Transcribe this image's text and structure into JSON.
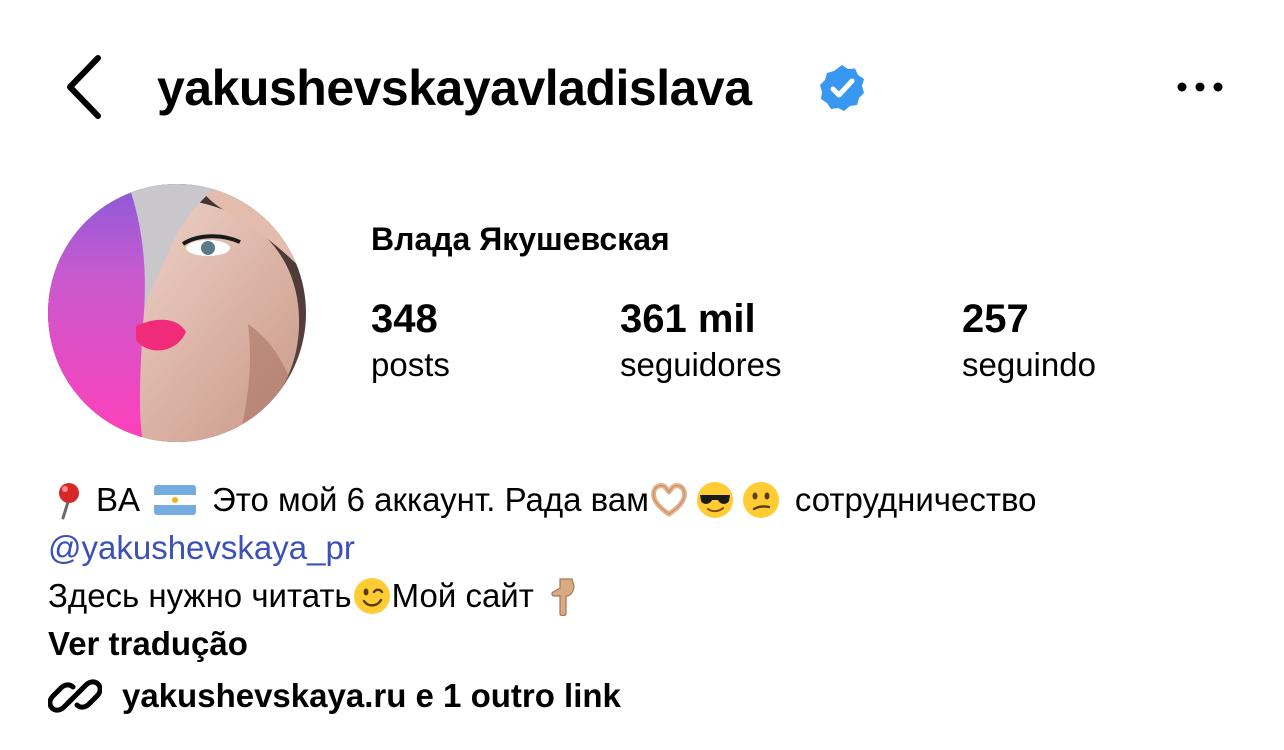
{
  "header": {
    "username": "yakushevskayavladislava",
    "back_icon": "chevron-left-icon",
    "verified_icon": "verified-badge-icon",
    "more_icon": "more-horizontal-icon",
    "verified_color": "#3897f0"
  },
  "profile": {
    "display_name": "Влада Якушевская",
    "stats": [
      {
        "value": "348",
        "label": "posts"
      },
      {
        "value": "361 mil",
        "label": "seguidores"
      },
      {
        "value": "257",
        "label": "seguindo"
      }
    ]
  },
  "bio": {
    "line1_location": "BA",
    "line1_text": "Это мой 6 аккаунт. Рада вам",
    "line1_end": "сотрудничество",
    "mention": "@yakushevskaya_pr",
    "line3_start": "Здесь нужно читать",
    "line3_end": "Мой сайт",
    "translate": "Ver tradução",
    "emojis": [
      "round-pushpin-icon",
      "argentina-flag-icon",
      "heart-hands-icon",
      "sunglasses-face-icon",
      "confused-face-icon",
      "winking-face-icon",
      "pointing-down-icon"
    ],
    "mention_color": "#3b50b8"
  },
  "links": {
    "text": "yakushevskaya.ru e 1 outro link",
    "icon": "link-icon"
  }
}
